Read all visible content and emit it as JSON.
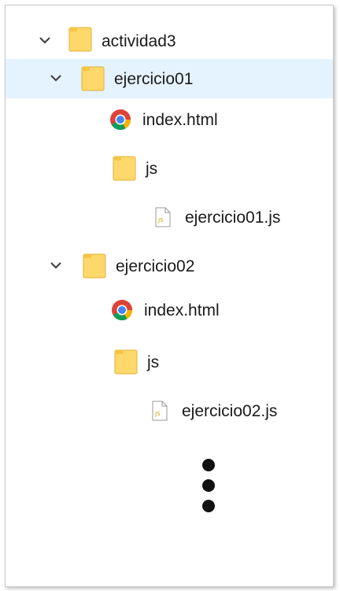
{
  "tree": {
    "root": {
      "label": "actividad3",
      "expanded": true,
      "icon": "folder-icon"
    },
    "folder1": {
      "label": "ejercicio01",
      "expanded": true,
      "selected": true,
      "icon": "folder-icon",
      "index_label": "index.html",
      "js_label": "js",
      "js_file_label": "ejercicio01.js"
    },
    "folder2": {
      "label": "ejercicio02",
      "expanded": true,
      "icon": "folder-icon",
      "index_label": "index.html",
      "js_label": "js",
      "js_file_label": "ejercicio02.js"
    }
  },
  "colors": {
    "selection_bg": "#e5f3ff",
    "folder_fill": "#ffd86b",
    "folder_stroke": "#e0b23a",
    "chevron": "#444444"
  }
}
